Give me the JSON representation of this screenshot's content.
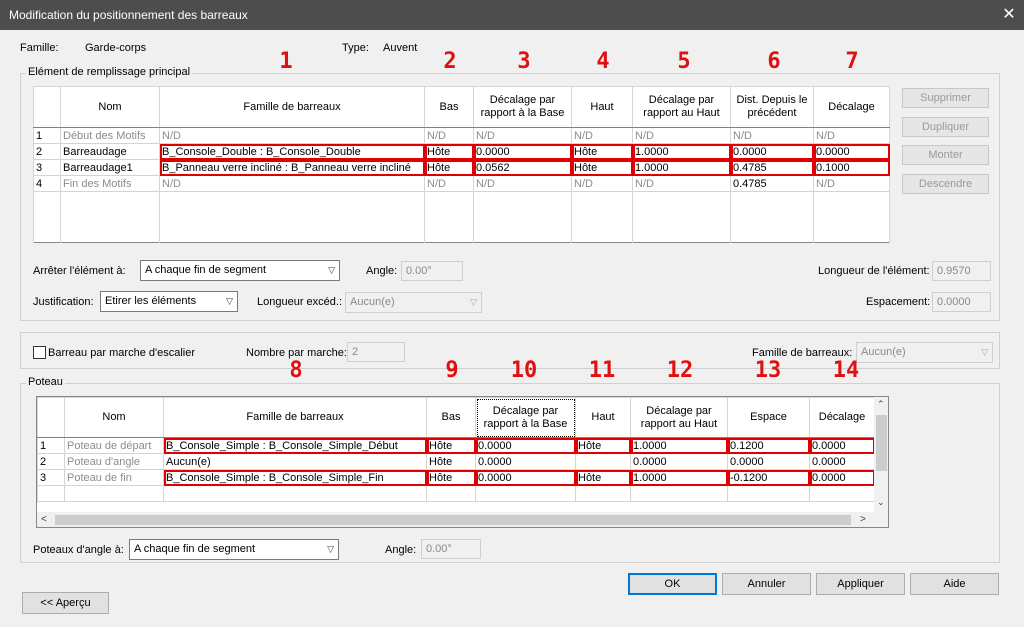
{
  "window": {
    "title": "Modification du positionnement des barreaux",
    "close_glyph": "✕"
  },
  "info": {
    "famille_label": "Famille:",
    "famille_value": "Garde-corps",
    "type_label": "Type:",
    "type_value": "Auvent"
  },
  "main_group": {
    "title": "Elément de remplissage principal",
    "annotations": [
      "1",
      "2",
      "3",
      "4",
      "5",
      "6",
      "7"
    ],
    "headers": [
      "Nom",
      "Famille de barreaux",
      "Bas",
      "Décalage par rapport à la Base",
      "Haut",
      "Décalage par rapport au Haut",
      "Dist. Depuis le précédent",
      "Décalage"
    ],
    "rows": [
      {
        "num": "1",
        "nom": "Début des Motifs",
        "famille": "N/D",
        "bas": "N/D",
        "dec_base": "N/D",
        "haut": "N/D",
        "dec_haut": "N/D",
        "dist": "N/D",
        "decalage": "N/D"
      },
      {
        "num": "2",
        "nom": "Barreaudage",
        "famille": "B_Console_Double : B_Console_Double",
        "bas": "Hôte",
        "dec_base": "0.0000",
        "haut": "Hôte",
        "dec_haut": "1.0000",
        "dist": "0.0000",
        "decalage": "0.0000"
      },
      {
        "num": "3",
        "nom": "Barreaudage1",
        "famille": "B_Panneau verre incliné : B_Panneau verre incliné",
        "bas": "Hôte",
        "dec_base": "0.0562",
        "haut": "Hôte",
        "dec_haut": "1.0000",
        "dist": "0.4785",
        "decalage": "0.1000"
      },
      {
        "num": "4",
        "nom": "Fin des Motifs",
        "famille": "N/D",
        "bas": "N/D",
        "dec_base": "N/D",
        "haut": "N/D",
        "dec_haut": "N/D",
        "dist": "0.4785",
        "decalage": "N/D"
      }
    ],
    "buttons": {
      "supprimer": "Supprimer",
      "dupliquer": "Dupliquer",
      "monter": "Monter",
      "descendre": "Descendre"
    },
    "arreter_label": "Arrêter l'élément à:",
    "arreter_value": "A chaque fin de segment",
    "angle_label": "Angle:",
    "angle_value": "0.00°",
    "longueur_elem_label": "Longueur de l'élément:",
    "longueur_elem_value": "0.9570",
    "justification_label": "Justification:",
    "justification_value": "Etirer les éléments",
    "longueur_exced_label": "Longueur excéd.:",
    "longueur_exced_value": "Aucun(e)",
    "espacement_label": "Espacement:",
    "espacement_value": "0.0000"
  },
  "stair": {
    "checkbox_label": "Barreau par marche d'escalier",
    "nombre_label": "Nombre par marche:",
    "nombre_value": "2",
    "famille_label": "Famille de barreaux:",
    "famille_value": "Aucun(e)"
  },
  "poteau_group": {
    "title": "Poteau",
    "annotations": [
      "8",
      "9",
      "10",
      "11",
      "12",
      "13",
      "14"
    ],
    "headers": [
      "Nom",
      "Famille de barreaux",
      "Bas",
      "Décalage par rapport à la Base",
      "Haut",
      "Décalage par rapport au Haut",
      "Espace",
      "Décalage"
    ],
    "rows": [
      {
        "num": "1",
        "nom": "Poteau de départ",
        "famille": "B_Console_Simple : B_Console_Simple_Début",
        "bas": "Hôte",
        "dec_base": "0.0000",
        "haut": "Hôte",
        "dec_haut": "1.0000",
        "espace": "0.1200",
        "decalage": "0.0000"
      },
      {
        "num": "2",
        "nom": "Poteau d'angle",
        "famille": "Aucun(e)",
        "bas": "Hôte",
        "dec_base": "0.0000",
        "haut": "",
        "dec_haut": "0.0000",
        "espace": "0.0000",
        "decalage": "0.0000"
      },
      {
        "num": "3",
        "nom": "Poteau de fin",
        "famille": "B_Console_Simple : B_Console_Simple_Fin",
        "bas": "Hôte",
        "dec_base": "0.0000",
        "haut": "Hôte",
        "dec_haut": "1.0000",
        "espace": "-0.1200",
        "decalage": "0.0000"
      }
    ],
    "poteaux_angle_label": "Poteaux d'angle à:",
    "poteaux_angle_value": "A chaque fin de segment",
    "angle_label": "Angle:",
    "angle_value": "0.00°"
  },
  "footer": {
    "ok": "OK",
    "annuler": "Annuler",
    "appliquer": "Appliquer",
    "aide": "Aide",
    "apercu": "<< Aperçu"
  }
}
